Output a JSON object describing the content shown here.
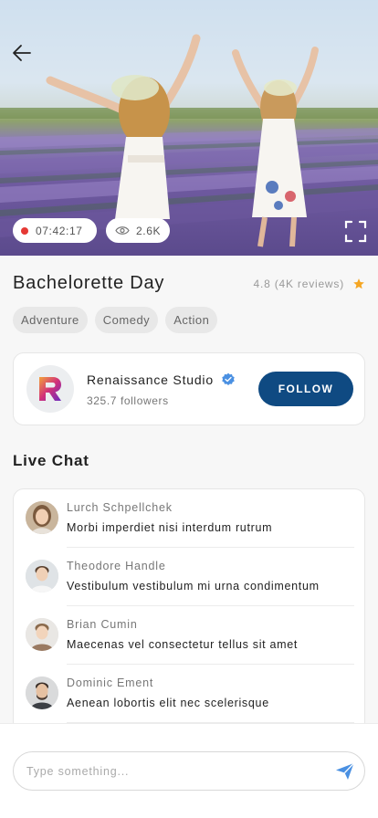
{
  "hero": {
    "live_time": "07:42:17",
    "view_count": "2.6K",
    "icons": {
      "back": "arrow-left-icon",
      "live": "live-dot-icon",
      "views": "eye-icon",
      "fullscreen": "fullscreen-icon"
    }
  },
  "event": {
    "title": "Bachelorette Day",
    "rating_text": "4.8 (4K reviews)",
    "star_color": "#f5a623",
    "tags": [
      "Adventure",
      "Comedy",
      "Action"
    ]
  },
  "studio": {
    "name": "Renaissance Studio",
    "followers": "325.7 followers",
    "verified": true,
    "follow_label": "FOLLOW",
    "accent_color": "#0f4a82"
  },
  "chat": {
    "heading": "Live Chat",
    "messages": [
      {
        "name": "Lurch Schpellchek",
        "text": "Morbi imperdiet nisi interdum rutrum"
      },
      {
        "name": "Theodore Handle",
        "text": "Vestibulum vestibulum mi urna condimentum"
      },
      {
        "name": "Brian Cumin",
        "text": "Maecenas vel consectetur tellus sit amet"
      },
      {
        "name": "Dominic Ement",
        "text": "Aenean lobortis elit nec scelerisque"
      }
    ]
  },
  "composer": {
    "placeholder": "Type something...",
    "send_icon": "send-icon"
  }
}
